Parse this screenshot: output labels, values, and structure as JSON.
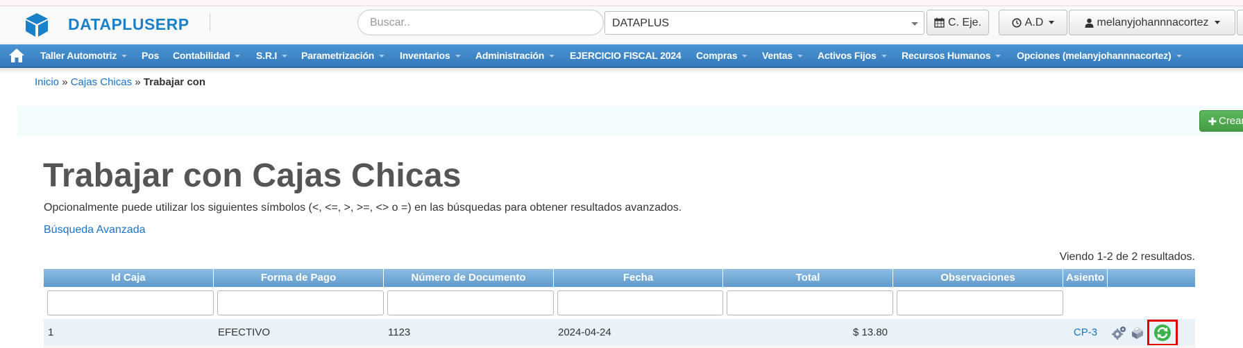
{
  "header": {
    "brand": "DATAPLUSERP",
    "search_placeholder": "Buscar..",
    "company": "DATAPLUS",
    "btn_cej": "C. Eje.",
    "btn_ad": "A.D",
    "user": "melanyjohannnacortez"
  },
  "nav": {
    "items": [
      "Taller Automotriz",
      "Pos",
      "Contabilidad",
      "S.R.I",
      "Parametrización",
      "Inventarios",
      "Administración",
      "EJERCICIO FISCAL 2024",
      "Compras",
      "Ventas",
      "Activos Fijos",
      "Recursos Humanos",
      "Opciones (melanyjohannnacortez)"
    ]
  },
  "breadcrumb": {
    "home": "Inicio",
    "sep": "»",
    "parent": "Cajas Chicas",
    "current": "Trabajar con"
  },
  "create_button": "Crear",
  "page": {
    "title": "Trabajar con Cajas Chicas",
    "help": "Opcionalmente puede utilizar los siguientes símbolos (<, <=, >, >=, <> o =) en las búsquedas para obtener resultados avanzados.",
    "advanced_search": "Búsqueda Avanzada",
    "summary": "Viendo 1-2 de 2 resultados."
  },
  "table": {
    "columns": [
      "Id Caja",
      "Forma de Pago",
      "Número de Documento",
      "Fecha",
      "Total",
      "Observaciones",
      "Asiento",
      ""
    ],
    "rows": [
      {
        "id": "1",
        "forma_pago": "EFECTIVO",
        "numero_documento": "1123",
        "fecha": "2024-04-24",
        "total": "$ 13.80",
        "observaciones": "",
        "asiento": "CP-3"
      }
    ]
  },
  "colors": {
    "brand": "#1a80c8",
    "navbar": "#3f87c8",
    "header_cell": "#6fa6d4",
    "row_bg": "#e8f2f8",
    "highlight": "#e00000",
    "create_green": "#5cb85c"
  },
  "icons": [
    "cube-logo-icon",
    "home-icon",
    "calendar-icon",
    "clock-icon",
    "user-icon",
    "plus-icon",
    "gears-icon",
    "print-icon",
    "refresh-icon"
  ]
}
